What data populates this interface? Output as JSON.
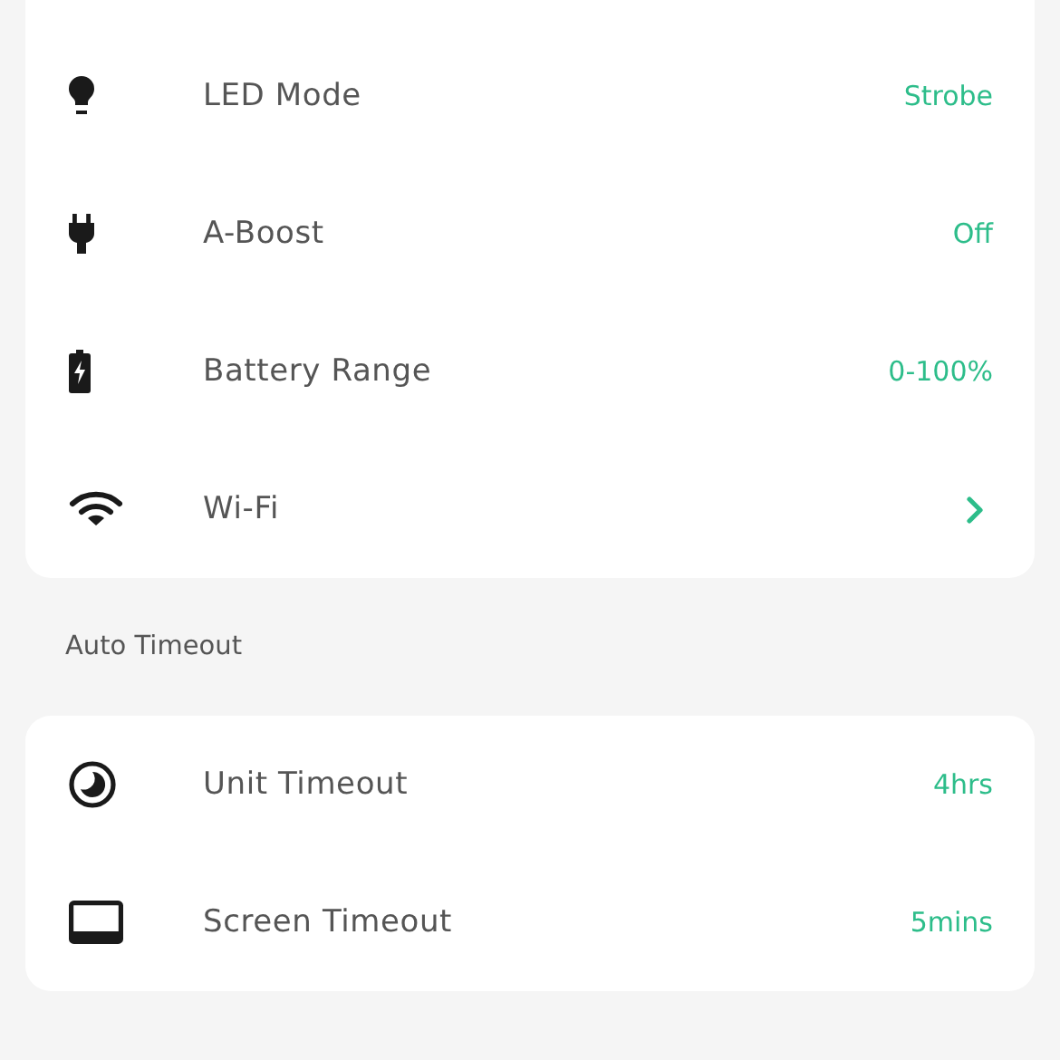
{
  "sections": [
    {
      "rows": [
        {
          "kind": "value",
          "label": "LED Mode",
          "value": "Strobe"
        },
        {
          "kind": "value",
          "label": "A-Boost",
          "value": "Off"
        },
        {
          "kind": "value",
          "label": "Battery Range",
          "value": "0-100%"
        },
        {
          "kind": "link",
          "label": "Wi-Fi"
        }
      ]
    },
    {
      "header": "Auto Timeout",
      "rows": [
        {
          "kind": "value",
          "label": "Unit Timeout",
          "value": "4hrs"
        },
        {
          "kind": "value",
          "label": "Screen Timeout",
          "value": "5mins"
        }
      ]
    }
  ]
}
